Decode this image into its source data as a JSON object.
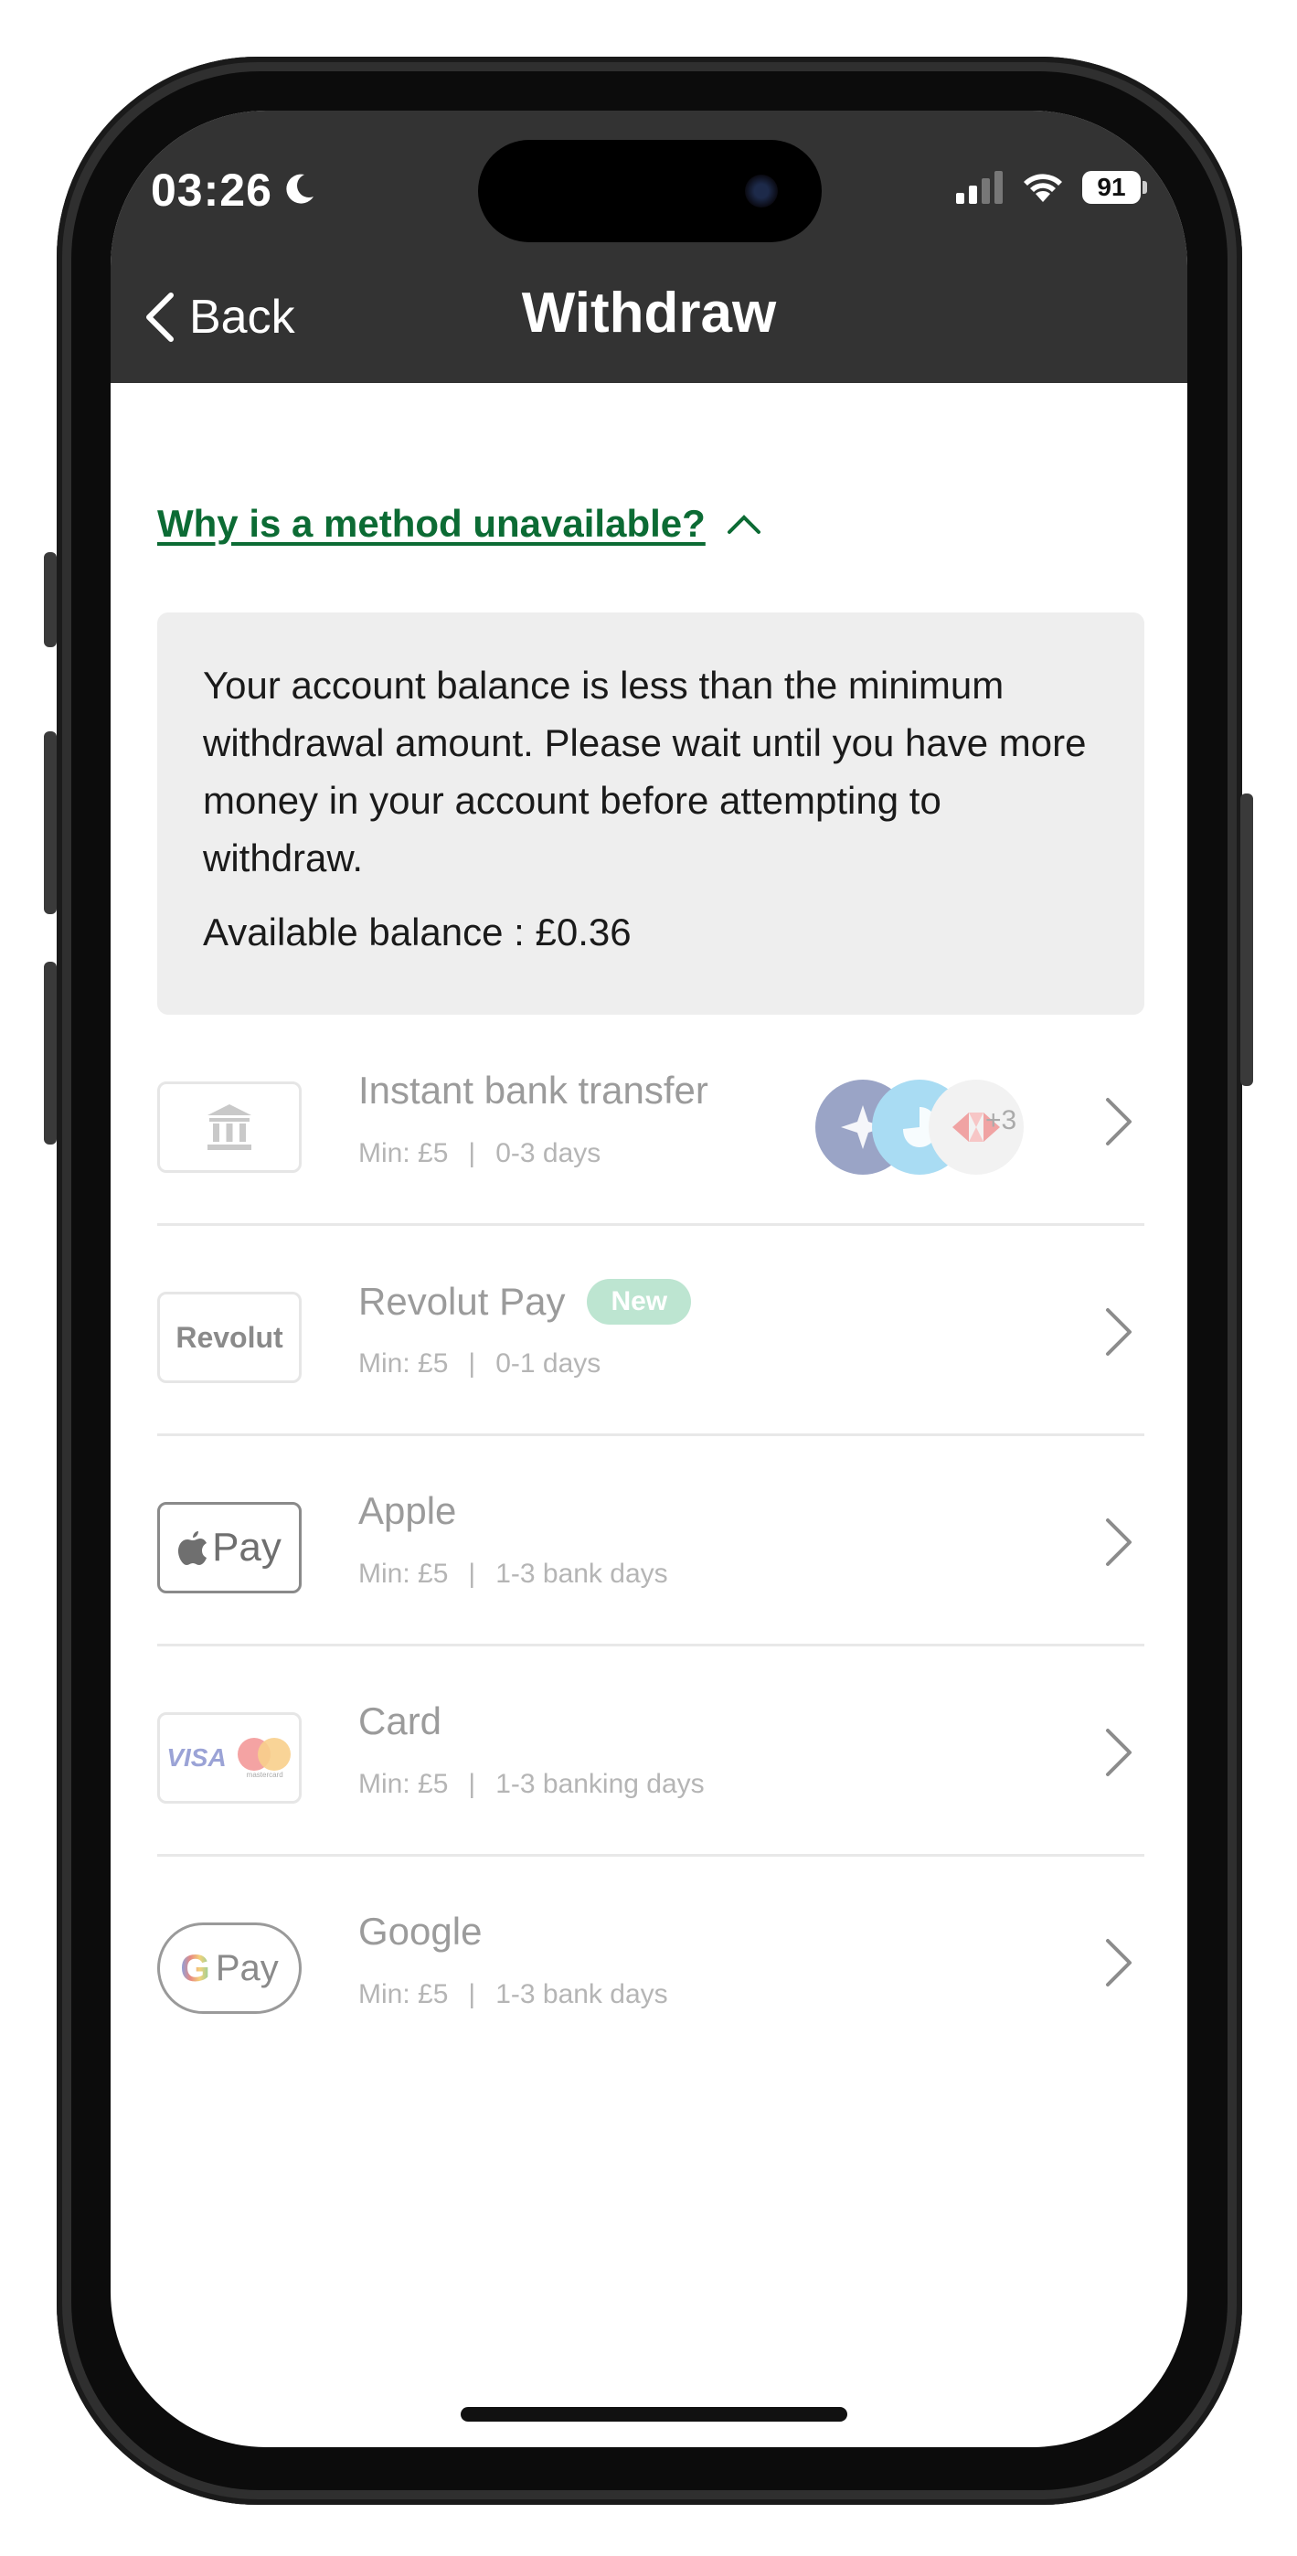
{
  "status_bar": {
    "time": "03:26",
    "battery": "91",
    "icons": [
      "moon-icon",
      "signal-icon",
      "wifi-icon",
      "battery-icon"
    ]
  },
  "nav": {
    "back_label": "Back",
    "title": "Withdraw",
    "icons": [
      "chevron-left-icon"
    ]
  },
  "info": {
    "toggle_label": "Why is a method unavailable?",
    "message": "Your account balance is less than the minimum withdrawal amount. Please wait until you have more money in your account before attempting to withdraw.",
    "balance": "Available balance : £0.36"
  },
  "methods": [
    {
      "title": "Instant bank transfer",
      "min": "Min: £5",
      "sep": "|",
      "time": "0-3 days",
      "extra": "+3",
      "logo": "bank-icon"
    },
    {
      "title": "Revolut Pay",
      "badge": "New",
      "min": "Min: £5",
      "sep": "|",
      "time": "0-1 days",
      "logo_text": "Revolut"
    },
    {
      "title": "Apple",
      "min": "Min: £5",
      "sep": "|",
      "time": "1-3 bank days",
      "logo_text": "Pay"
    },
    {
      "title": "Card",
      "min": "Min: £5",
      "sep": "|",
      "time": "1-3 banking days",
      "logo_text": "VISA",
      "logo_sub": "mastercard"
    },
    {
      "title": "Google",
      "min": "Min: £5",
      "sep": "|",
      "time": "1-3 bank days",
      "logo_text": "Pay",
      "logo_g": "G"
    }
  ],
  "colors": {
    "header_bg": "#333333",
    "link_green": "#0c6b34",
    "badge_mint": "#bde5d1",
    "info_bg": "#eeeeee"
  }
}
